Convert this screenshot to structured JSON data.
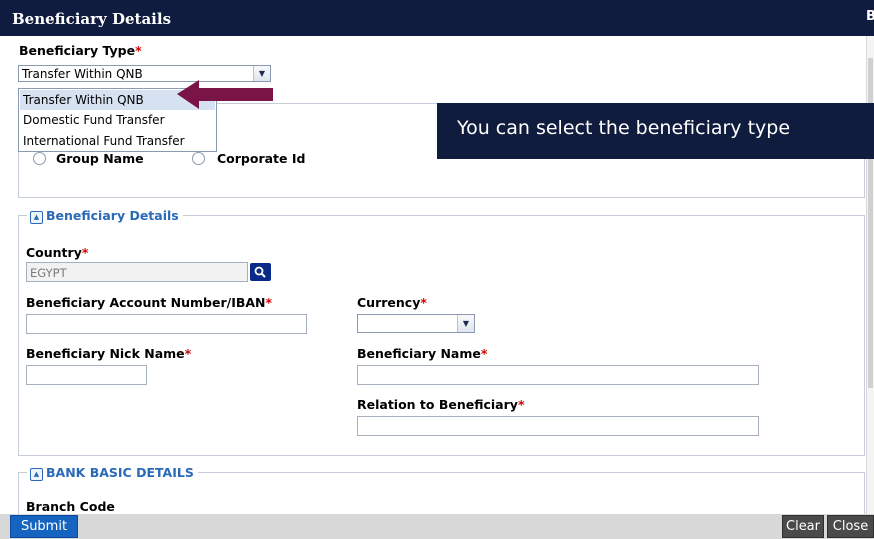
{
  "window": {
    "title": "Beneficiary Details"
  },
  "beneficiary_type": {
    "label": "Beneficiary Type",
    "required_mark": "*",
    "selected": "Transfer Within QNB",
    "options": [
      "Transfer Within QNB",
      "Domestic Fund Transfer",
      "International Fund Transfer"
    ]
  },
  "group_section": {
    "radio_1_label": "Group Name",
    "radio_2_label": "Corporate Id"
  },
  "tooltip": {
    "text": "You can select the beneficiary type"
  },
  "beneficiary_details": {
    "legend": "Beneficiary Details",
    "toggle_glyph": "▲",
    "country_label": "Country",
    "country_value": "EGYPT",
    "account_label": "Beneficiary Account Number/IBAN",
    "currency_label": "Currency",
    "nickname_label": "Beneficiary Nick Name",
    "name_label": "Beneficiary Name",
    "relation_label": "Relation to Beneficiary",
    "required_mark": "*"
  },
  "bank_basic_details": {
    "legend": "BANK BASIC DETAILS",
    "toggle_glyph": "▲",
    "branch_code_label": "Branch Code"
  },
  "footer": {
    "submit_label": "Submit",
    "clear_label": "Clear",
    "close_label": "Close"
  },
  "colors": {
    "titlebar": "#0f1c3f",
    "tooltip_bg": "#101c3d",
    "pointer_arrow": "#7a1446",
    "legend_blue": "#2a6ab8",
    "required_red": "#d60000",
    "submit_blue": "#1565c0"
  },
  "icons": {
    "dropdown_arrow": "chevron-down-icon",
    "country_search": "search-icon",
    "section_toggle": "collapse-up-icon",
    "pointer": "left-arrow-icon"
  }
}
